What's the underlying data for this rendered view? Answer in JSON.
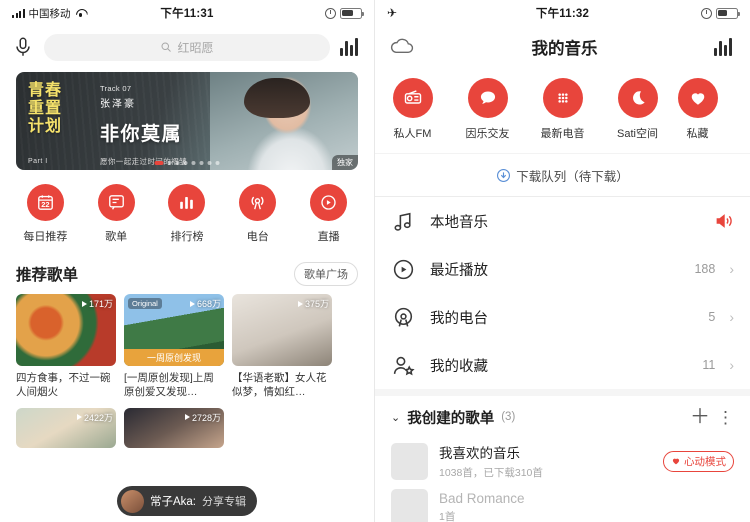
{
  "left": {
    "status": {
      "carrier": "中国移动",
      "time": "下午11:31",
      "signal_icon": "signal-bars-icon",
      "wifi_icon": "wifi-icon",
      "alarm_icon": "alarm-clock-icon",
      "battery_icon": "battery-icon"
    },
    "topbar": {
      "mic_icon": "microphone-icon",
      "search_placeholder": "红昭愿",
      "search_icon": "search-icon",
      "eq_icon": "equalizer-icon"
    },
    "banner": {
      "title_line1": "青春",
      "title_line2": "重置",
      "title_line3": "计划",
      "subtitle": "Part I",
      "track": "Track 07",
      "artist": "张泽豪",
      "song": "非你莫属",
      "desc": "愿你一起走过时间的褶皱",
      "badge": "独家",
      "dots_total": 8,
      "dots_active": 1
    },
    "quicknav": [
      {
        "label": "每日推荐",
        "icon": "calendar-icon",
        "day": "22"
      },
      {
        "label": "歌单",
        "icon": "playlist-icon"
      },
      {
        "label": "排行榜",
        "icon": "chart-bars-icon"
      },
      {
        "label": "电台",
        "icon": "radio-broadcast-icon"
      },
      {
        "label": "直播",
        "icon": "live-stream-icon"
      }
    ],
    "section": {
      "title": "推荐歌单",
      "pill": "歌单广场"
    },
    "cards_row1": [
      {
        "plays": "171万",
        "text": "四方食事，不过一碗人间烟火",
        "art": "img-food"
      },
      {
        "plays": "668万",
        "text": "[一周原创发现]上周原创爱又发现…",
        "art": "img-forest",
        "tag": "Original",
        "ribbon": "一周原创发现"
      },
      {
        "plays": "375万",
        "text": "【华语老歌】女人花似梦，情如红…",
        "art": "img-bride"
      }
    ],
    "cards_row2": [
      {
        "plays": "2422万",
        "text": "",
        "art": "img-kids"
      },
      {
        "plays": "2728万",
        "text": "",
        "art": "img-singer"
      }
    ],
    "miniplayer": {
      "title": "常子Aka:",
      "subtitle": "分享专辑",
      "avatar_icon": "avatar-icon"
    }
  },
  "right": {
    "status": {
      "plane_icon": "airplane-mode-icon",
      "time": "下午11:32",
      "alarm_icon": "alarm-clock-icon",
      "battery_icon": "battery-icon"
    },
    "topbar": {
      "cloud_icon": "cloud-icon",
      "title": "我的音乐",
      "eq_icon": "equalizer-icon"
    },
    "quicknav": [
      {
        "label": "私人FM",
        "icon": "radio-fm-icon"
      },
      {
        "label": "因乐交友",
        "icon": "chat-bubble-icon"
      },
      {
        "label": "最新电音",
        "icon": "grid-dots-icon"
      },
      {
        "label": "Sati空间",
        "icon": "moon-icon"
      },
      {
        "label": "私藏",
        "icon": "heart-icon"
      }
    ],
    "download_queue": {
      "label": "下载队列（待下载）",
      "icon": "download-icon"
    },
    "rows": [
      {
        "label": "本地音乐",
        "icon": "music-note-icon",
        "count": "",
        "trailing": "speaker-icon"
      },
      {
        "label": "最近播放",
        "icon": "history-play-icon",
        "count": "188",
        "trailing": "chevron-right-icon"
      },
      {
        "label": "我的电台",
        "icon": "radio-antenna-icon",
        "count": "5",
        "trailing": "chevron-right-icon"
      },
      {
        "label": "我的收藏",
        "icon": "person-star-icon",
        "count": "11",
        "trailing": "chevron-right-icon"
      }
    ],
    "created": {
      "caret_icon": "chevron-down-icon",
      "title": "我创建的歌单",
      "count": "(3)",
      "add_icon": "plus-icon",
      "more_icon": "kebab-menu-icon"
    },
    "playlists": [
      {
        "name": "我喜欢的音乐",
        "meta": "1038首，已下载310首",
        "badge": "心动模式",
        "badge_icon": "heart-icon",
        "dim": false
      },
      {
        "name": "Bad Romance",
        "meta": "1首",
        "dim": true
      }
    ]
  },
  "colors": {
    "accent": "#e8453c",
    "text": "#1f1f1f",
    "muted": "#9a9a9a",
    "bg": "#ffffff",
    "divider": "#ececec"
  }
}
